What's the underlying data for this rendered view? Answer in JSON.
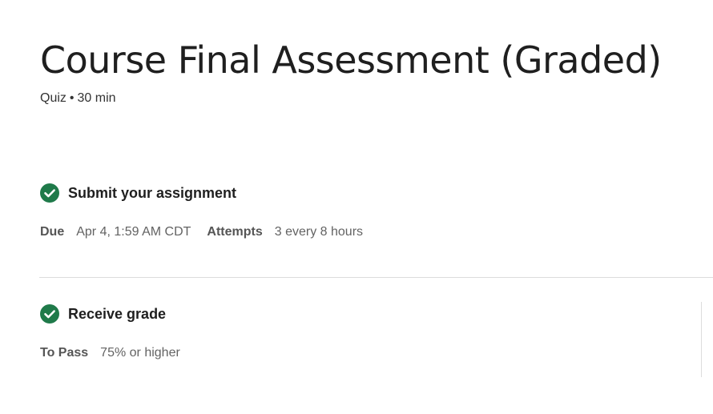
{
  "header": {
    "title": "Course Final Assessment (Graded)",
    "type": "Quiz",
    "separator": "•",
    "duration": "30 min"
  },
  "submit_section": {
    "icon": "check-circle-icon",
    "title": "Submit your assignment",
    "due_label": "Due",
    "due_value": "Apr 4, 1:59 AM CDT",
    "attempts_label": "Attempts",
    "attempts_value": "3 every 8 hours"
  },
  "grade_section": {
    "icon": "check-circle-icon",
    "title": "Receive grade",
    "pass_label": "To Pass",
    "pass_value": "75% or higher"
  },
  "colors": {
    "check_green": "#1f7a4a",
    "divider": "#dcdcdc"
  }
}
